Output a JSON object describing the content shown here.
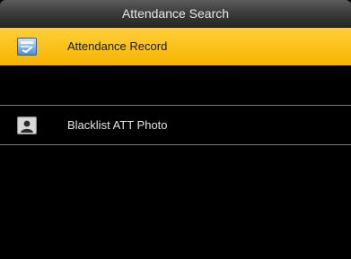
{
  "header": {
    "title": "Attendance Search"
  },
  "menu": {
    "items": [
      {
        "label": "Attendance Record",
        "icon": "attendance-record-icon",
        "selected": true
      },
      {
        "label": "Blacklist ATT Photo",
        "icon": "person-photo-icon",
        "selected": false
      }
    ]
  },
  "colors": {
    "highlight": "#f7b400",
    "background": "#000000",
    "title_text": "#e8e8e8"
  }
}
